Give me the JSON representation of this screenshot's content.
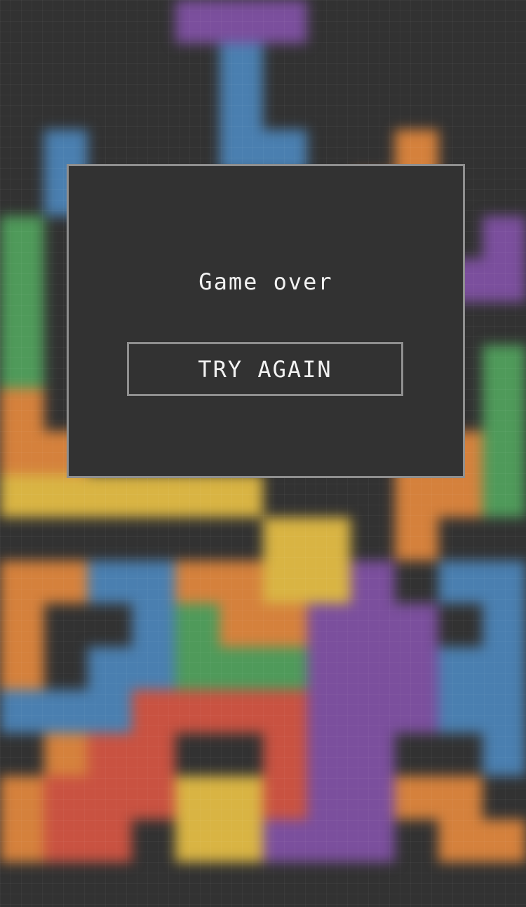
{
  "modal": {
    "title": "Game over",
    "button_label": "TRY AGAIN"
  },
  "colors": {
    "background": "#323232",
    "border": "#8f8f8f",
    "text": "#f2f2f2",
    "purple": "#7b4f9d",
    "blue": "#4a7fb0",
    "orange": "#d5813c",
    "green": "#4f9a5a",
    "yellow": "#d9b443",
    "red": "#c95241"
  },
  "board": {
    "columns": 12,
    "rows": 20,
    "cells": [
      [
        4,
        0,
        "purple"
      ],
      [
        5,
        0,
        "purple"
      ],
      [
        6,
        0,
        "purple"
      ],
      [
        5,
        1,
        "blue"
      ],
      [
        5,
        2,
        "blue"
      ],
      [
        5,
        3,
        "blue"
      ],
      [
        6,
        3,
        "blue"
      ],
      [
        1,
        3,
        "blue"
      ],
      [
        1,
        4,
        "blue"
      ],
      [
        9,
        3,
        "orange"
      ],
      [
        8,
        4,
        "orange"
      ],
      [
        9,
        4,
        "orange"
      ],
      [
        11,
        5,
        "purple"
      ],
      [
        11,
        6,
        "purple"
      ],
      [
        10,
        6,
        "purple"
      ],
      [
        0,
        5,
        "green"
      ],
      [
        0,
        6,
        "green"
      ],
      [
        0,
        7,
        "green"
      ],
      [
        0,
        8,
        "green"
      ],
      [
        11,
        8,
        "green"
      ],
      [
        11,
        9,
        "green"
      ],
      [
        11,
        10,
        "green"
      ],
      [
        11,
        11,
        "green"
      ],
      [
        0,
        9,
        "orange"
      ],
      [
        0,
        10,
        "orange"
      ],
      [
        1,
        10,
        "orange"
      ],
      [
        9,
        10,
        "orange"
      ],
      [
        10,
        10,
        "orange"
      ],
      [
        9,
        11,
        "orange"
      ],
      [
        10,
        11,
        "orange"
      ],
      [
        9,
        12,
        "orange"
      ],
      [
        0,
        11,
        "yellow"
      ],
      [
        1,
        11,
        "yellow"
      ],
      [
        2,
        11,
        "yellow"
      ],
      [
        3,
        11,
        "yellow"
      ],
      [
        4,
        11,
        "yellow"
      ],
      [
        5,
        11,
        "yellow"
      ],
      [
        6,
        12,
        "yellow"
      ],
      [
        7,
        12,
        "yellow"
      ],
      [
        6,
        13,
        "yellow"
      ],
      [
        7,
        13,
        "yellow"
      ],
      [
        4,
        13,
        "orange"
      ],
      [
        5,
        13,
        "orange"
      ],
      [
        5,
        14,
        "orange"
      ],
      [
        6,
        14,
        "orange"
      ],
      [
        0,
        13,
        "orange"
      ],
      [
        1,
        13,
        "orange"
      ],
      [
        0,
        14,
        "orange"
      ],
      [
        0,
        15,
        "orange"
      ],
      [
        2,
        13,
        "blue"
      ],
      [
        3,
        13,
        "blue"
      ],
      [
        3,
        14,
        "blue"
      ],
      [
        3,
        15,
        "blue"
      ],
      [
        2,
        15,
        "blue"
      ],
      [
        1,
        16,
        "blue"
      ],
      [
        0,
        16,
        "blue"
      ],
      [
        2,
        16,
        "blue"
      ],
      [
        10,
        13,
        "blue"
      ],
      [
        11,
        13,
        "blue"
      ],
      [
        11,
        14,
        "blue"
      ],
      [
        11,
        15,
        "blue"
      ],
      [
        11,
        16,
        "blue"
      ],
      [
        11,
        17,
        "blue"
      ],
      [
        10,
        15,
        "blue"
      ],
      [
        10,
        16,
        "blue"
      ],
      [
        4,
        14,
        "green"
      ],
      [
        4,
        15,
        "green"
      ],
      [
        5,
        15,
        "green"
      ],
      [
        6,
        15,
        "green"
      ],
      [
        8,
        13,
        "purple"
      ],
      [
        7,
        14,
        "purple"
      ],
      [
        8,
        14,
        "purple"
      ],
      [
        9,
        14,
        "purple"
      ],
      [
        7,
        15,
        "purple"
      ],
      [
        8,
        15,
        "purple"
      ],
      [
        9,
        15,
        "purple"
      ],
      [
        7,
        16,
        "purple"
      ],
      [
        8,
        16,
        "purple"
      ],
      [
        9,
        16,
        "purple"
      ],
      [
        7,
        17,
        "purple"
      ],
      [
        8,
        17,
        "purple"
      ],
      [
        7,
        18,
        "purple"
      ],
      [
        8,
        18,
        "purple"
      ],
      [
        6,
        16,
        "red"
      ],
      [
        5,
        16,
        "red"
      ],
      [
        4,
        16,
        "red"
      ],
      [
        3,
        16,
        "red"
      ],
      [
        3,
        17,
        "red"
      ],
      [
        6,
        17,
        "red"
      ],
      [
        2,
        17,
        "red"
      ],
      [
        1,
        18,
        "red"
      ],
      [
        2,
        18,
        "red"
      ],
      [
        3,
        18,
        "red"
      ],
      [
        6,
        18,
        "red"
      ],
      [
        1,
        17,
        "orange"
      ],
      [
        0,
        18,
        "orange"
      ],
      [
        0,
        19,
        "orange"
      ],
      [
        1,
        19,
        "red"
      ],
      [
        2,
        19,
        "red"
      ],
      [
        4,
        18,
        "yellow"
      ],
      [
        5,
        18,
        "yellow"
      ],
      [
        4,
        19,
        "yellow"
      ],
      [
        5,
        19,
        "yellow"
      ],
      [
        6,
        19,
        "purple"
      ],
      [
        7,
        19,
        "purple"
      ],
      [
        8,
        19,
        "purple"
      ],
      [
        9,
        18,
        "orange"
      ],
      [
        10,
        18,
        "orange"
      ],
      [
        10,
        19,
        "orange"
      ],
      [
        11,
        19,
        "orange"
      ]
    ]
  }
}
